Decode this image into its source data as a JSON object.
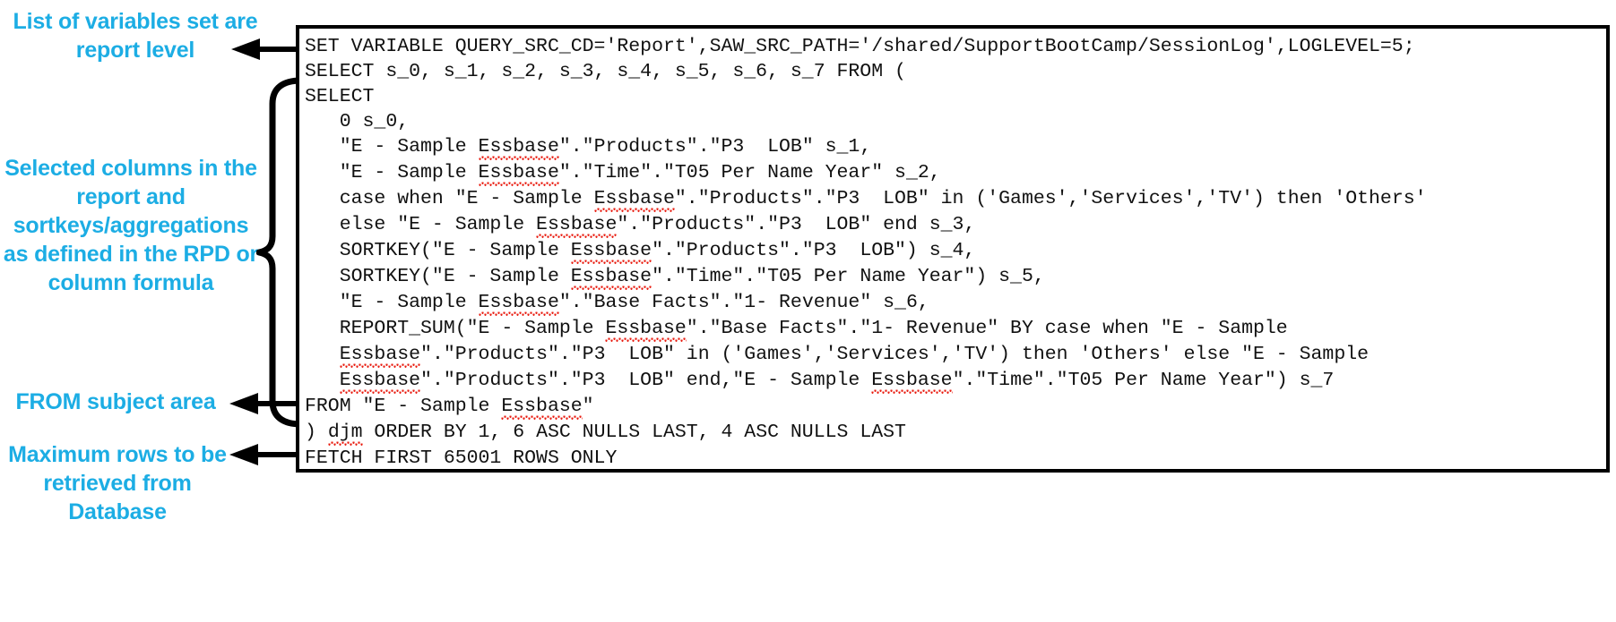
{
  "page": {
    "title": "Logical SQL query with annotations",
    "background_color": "#FFFFFF",
    "annotation_color": "#1CADE4",
    "code_text_color": "#111111",
    "spellcheck_underline_color": "#E8180C",
    "border_color": "#000000"
  },
  "annotations": [
    {
      "id": "variables",
      "text": "List of variables set are report level",
      "connector": "straight-arrow-left",
      "points_to_line": 1
    },
    {
      "id": "columns",
      "text": "Selected columns in the report and sortkeys/aggregations as defined in the RPD or column formula",
      "connector": "curly-brace",
      "points_to_line": "2-17"
    },
    {
      "id": "from",
      "text": "FROM subject area",
      "connector": "straight-arrow-left",
      "points_to_line": 18
    },
    {
      "id": "maxrows",
      "text": "Maximum rows to be retrieved from Database",
      "connector": "straight-arrow-left",
      "points_to_line": 20
    }
  ],
  "code": {
    "language": "Logical SQL",
    "lines": [
      [
        {
          "t": "SET VARIABLE QUERY_SRC_CD='Report',SAW_SRC_PATH='/shared/SupportBootCamp/SessionLog',LOGLEVEL=5;"
        }
      ],
      [
        {
          "t": "SELECT s_0, s_1, s_2, s_3, s_4, s_5, s_6, s_7 FROM ("
        }
      ],
      [
        {
          "t": "SELECT"
        }
      ],
      [
        {
          "t": "   0 s_0,"
        }
      ],
      [
        {
          "t": "   \"E - Sample "
        },
        {
          "t": "Essbase",
          "sp": true
        },
        {
          "t": "\".\"Products\".\"P3  LOB\" s_1,"
        }
      ],
      [
        {
          "t": "   \"E - Sample "
        },
        {
          "t": "Essbase",
          "sp": true
        },
        {
          "t": "\".\"Time\".\"T05 Per Name Year\" s_2,"
        }
      ],
      [
        {
          "t": "   case when \"E - Sample "
        },
        {
          "t": "Essbase",
          "sp": true
        },
        {
          "t": "\".\"Products\".\"P3  LOB\" in ('Games','Services','TV') then 'Others'"
        }
      ],
      [
        {
          "t": "   else \"E - Sample "
        },
        {
          "t": "Essbase",
          "sp": true
        },
        {
          "t": "\".\"Products\".\"P3  LOB\" end s_3,"
        }
      ],
      [
        {
          "t": "   SORTKEY(\"E - Sample "
        },
        {
          "t": "Essbase",
          "sp": true
        },
        {
          "t": "\".\"Products\".\"P3  LOB\") s_4,"
        }
      ],
      [
        {
          "t": "   SORTKEY(\"E - Sample "
        },
        {
          "t": "Essbase",
          "sp": true
        },
        {
          "t": "\".\"Time\".\"T05 Per Name Year\") s_5,"
        }
      ],
      [
        {
          "t": "   \"E - Sample "
        },
        {
          "t": "Essbase",
          "sp": true
        },
        {
          "t": "\".\"Base Facts\".\"1- Revenue\" s_6,"
        }
      ],
      [
        {
          "t": "   REPORT_SUM(\"E - Sample "
        },
        {
          "t": "Essbase",
          "sp": true
        },
        {
          "t": "\".\"Base Facts\".\"1- Revenue\" BY case when \"E - Sample"
        }
      ],
      [
        {
          "t": "   "
        },
        {
          "t": "Essbase",
          "sp": true
        },
        {
          "t": "\".\"Products\".\"P3  LOB\" in ('Games','Services','TV') then 'Others' else \"E - Sample"
        }
      ],
      [
        {
          "t": "   "
        },
        {
          "t": "Essbase",
          "sp": true
        },
        {
          "t": "\".\"Products\".\"P3  LOB\" end,\"E - Sample "
        },
        {
          "t": "Essbase",
          "sp": true
        },
        {
          "t": "\".\"Time\".\"T05 Per Name Year\") s_7"
        }
      ],
      [
        {
          "t": "FROM \"E - Sample "
        },
        {
          "t": "Essbase",
          "sp": true
        },
        {
          "t": "\""
        }
      ],
      [
        {
          "t": ") "
        },
        {
          "t": "djm",
          "sp": true
        },
        {
          "t": " ORDER BY 1, 6 ASC NULLS LAST, 4 ASC NULLS LAST"
        }
      ],
      [
        {
          "t": "FETCH FIRST 65001 ROWS ONLY"
        }
      ]
    ]
  }
}
